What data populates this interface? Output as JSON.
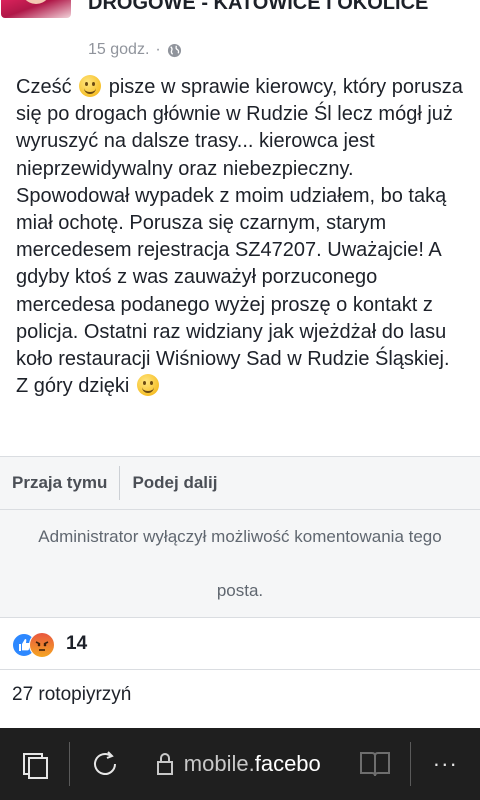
{
  "post": {
    "group_name": "DROGOWE - KATOWICE I OKOLICE",
    "time": "15 godz.",
    "separator": "·",
    "body": [
      "Cześć",
      " pisze w sprawie kierowcy, który porusza się po drogach głównie w Rudzie Śl lecz mógł już wyruszyć na dalsze trasy... kierowca jest nieprzewidywalny oraz niebezpieczny. Spowodował wypadek z moim udziałem, bo taką miał ochotę. Porusza się czarnym, starym mercedesem rejestracja SZ47207. Uważajcie! A gdyby ktoś z was zauważył porzuconego mercedesa podanego wyżej proszę o kontakt z policja. Ostatni raz widziany jak wjeżdżał do lasu koło restauracji Wiśniowy Sad w Rudzie Śląskiej. Z góry dzięki"
    ]
  },
  "actions": {
    "like_label": "Przaja tymu",
    "share_label": "Podej dalij"
  },
  "notice": {
    "line1": "Administrator wyłączył możliwość komentowania tego",
    "line2": "posta."
  },
  "reactions": {
    "icons": [
      "like-icon",
      "angry-icon"
    ],
    "count": "14"
  },
  "comments": {
    "label": "27 rotopiyrzyń"
  },
  "browser": {
    "address_domain": "mobile.",
    "address_rest": "facebo",
    "more_label": "···"
  }
}
